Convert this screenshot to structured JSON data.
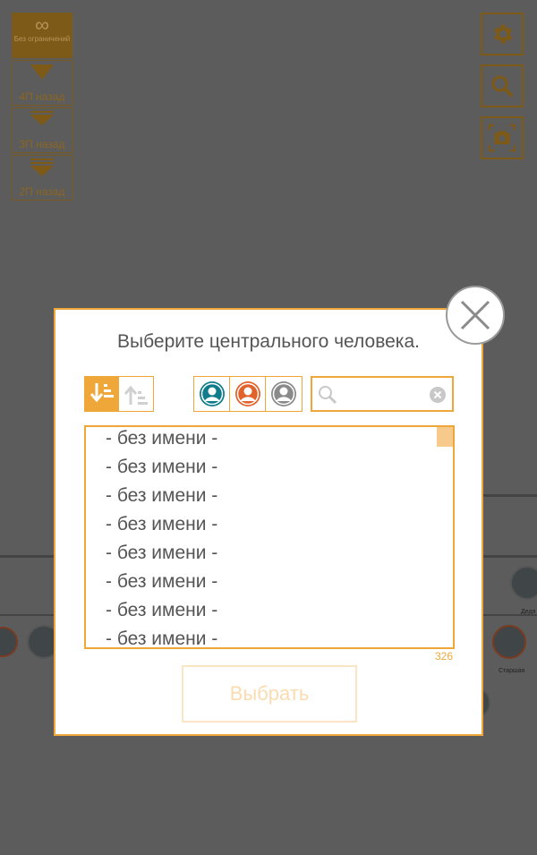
{
  "generation_filters": [
    {
      "label": "Без ограничений",
      "active": true
    },
    {
      "label": "4П назад"
    },
    {
      "label": "3П назад"
    },
    {
      "label": "2П назад"
    }
  ],
  "tools": [
    {
      "icon": "gear-icon"
    },
    {
      "icon": "search-icon"
    },
    {
      "icon": "camera-icon"
    }
  ],
  "tree_labels": {
    "node_a": "Дедя",
    "node_b": "Старшая"
  },
  "dialog": {
    "title": "Выберите центрального человека.",
    "search": {
      "value": "",
      "placeholder": ""
    },
    "items": [
      "- без имени -",
      "- без имени -",
      "- без имени -",
      "- без имени -",
      "- без имени -",
      "- без имени -",
      "- без имени -",
      "- без имени -"
    ],
    "count": "326",
    "select_label": "Выбрать"
  },
  "colors": {
    "accent": "#f0a73a",
    "overlay": "#5c5c5c",
    "male": "#0f7c8c",
    "female": "#e2622c",
    "unknown": "#8a8a8a"
  }
}
